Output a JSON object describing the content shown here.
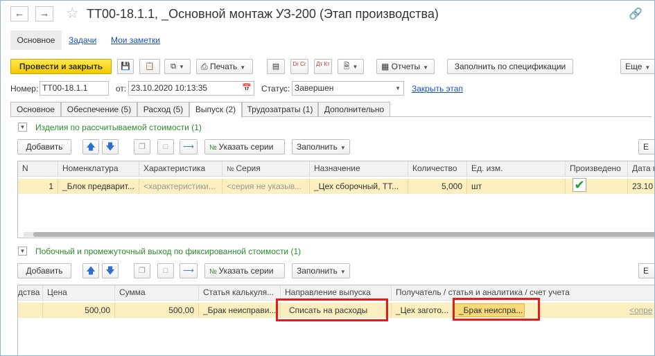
{
  "window": {
    "title": "ТТ00-18.1.1, _Основной монтаж УЗ-200 (Этап производства)"
  },
  "nav": {
    "tabs": [
      {
        "label": "Основное"
      },
      {
        "label": "Задачи"
      },
      {
        "label": "Мои заметки"
      }
    ]
  },
  "toolbar": {
    "post_close": "Провести и закрыть",
    "print": "Печать",
    "dt_cr": "Dr Cr",
    "dt_kt": "Дт Кт",
    "reports": "Отчеты",
    "fill_spec": "Заполнить по спецификации",
    "more": "Еще"
  },
  "header": {
    "number_label": "Номер:",
    "number_value": "ТТ00-18.1.1",
    "date_label": "от:",
    "date_value": "23.10.2020 10:13:35",
    "status_label": "Статус:",
    "status_value": "Завершен",
    "close_stage": "Закрыть этап"
  },
  "doc_tabs": [
    {
      "label": "Основное"
    },
    {
      "label": "Обеспечение (5)"
    },
    {
      "label": "Расход (5)"
    },
    {
      "label": "Выпуск (2)"
    },
    {
      "label": "Трудозатраты (1)"
    },
    {
      "label": "Дополнительно"
    }
  ],
  "section1": {
    "title": "Изделия по рассчитываемой стоимости (1)",
    "add": "Добавить",
    "series": "Указать серии",
    "fill": "Заполнить",
    "more_cut": "Е",
    "columns": [
      "N",
      "Номенклатура",
      "Характеристика",
      "Серия",
      "Назначение",
      "Количество",
      "Ед. изм.",
      "Произведено",
      "Дата п"
    ],
    "row": {
      "n": "1",
      "item": "_Блок предварит...",
      "characteristic": "<характеристики...",
      "series": "<серия не указыв...",
      "purpose": "_Цех сборочный, ТТ...",
      "qty": "5,000",
      "unit": "шт",
      "date": "23.10"
    }
  },
  "section2": {
    "title": "Побочный и промежуточный выход по фиксированной стоимости (1)",
    "add": "Добавить",
    "series": "Указать серии",
    "fill": "Заполнить",
    "more_cut": "Е",
    "columns": [
      "дства",
      "Цена",
      "Сумма",
      "Статья калькуля...",
      "Направление выпуска",
      "Получатель / статья и аналитика / счет учета"
    ],
    "row": {
      "price": "500,00",
      "sum": "500,00",
      "cost_item": "_Брак неисправи...",
      "direction": "Списать на расходы",
      "recipient": "_Цех загото...",
      "account": "_Брак неиспра...",
      "more": "<опре"
    }
  },
  "colors": {
    "accent_yellow": "#f5c800",
    "row_highlight": "#fbefc0",
    "section_green": "#2a8c2a",
    "link_blue": "#1a4fbf",
    "annotation_red": "#e21b1b"
  }
}
